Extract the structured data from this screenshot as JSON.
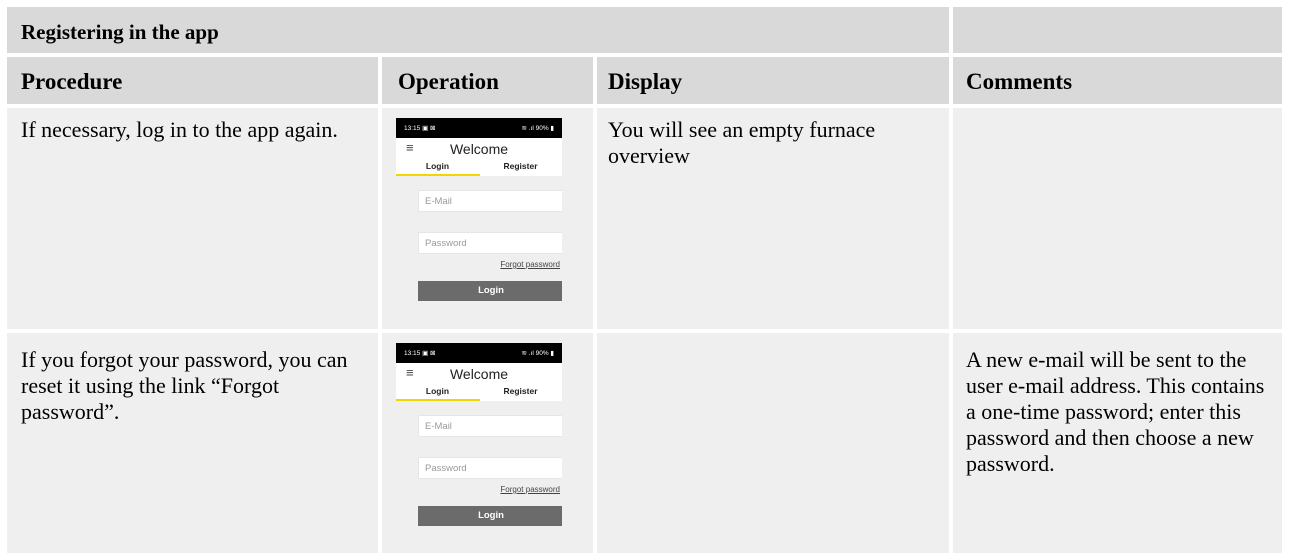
{
  "section_title": "Registering in the app",
  "columns": [
    "Procedure",
    "Operation",
    "Display",
    "Comments"
  ],
  "rows": [
    {
      "procedure": "If necessary, log in to the app again.",
      "display": "You will see an empty furnace overview",
      "comments": ""
    },
    {
      "procedure": "If you forgot your password, you can reset it using the link “Forgot password”.",
      "display": "",
      "comments": "A new e-mail will be sent to the user e-mail address. This contains a one-time password; enter this password and then choose a new password."
    }
  ],
  "phone": {
    "status_left": "13:15 ▣ ⊠",
    "status_right": "≋ .ıl 90% ▮",
    "menu_icon": "hamburger-menu-icon",
    "title": "Welcome",
    "tab_login": "Login",
    "tab_register": "Register",
    "email_placeholder": "E-Mail",
    "password_placeholder": "Password",
    "forgot_link": "Forgot password",
    "login_button": "Login",
    "accent_color": "#f2d600"
  }
}
